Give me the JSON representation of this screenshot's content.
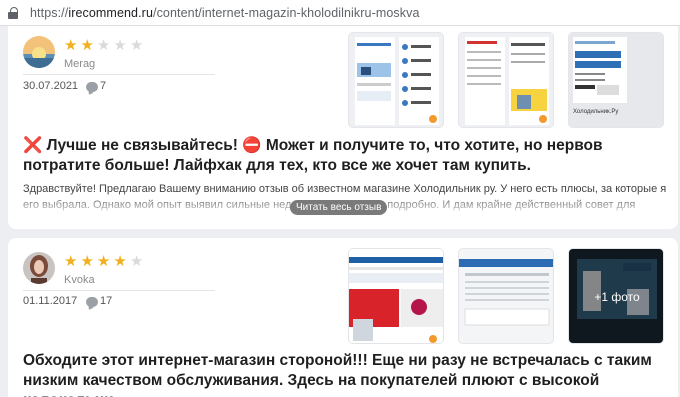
{
  "browser": {
    "url_prefix": "https://",
    "url_domain": "irecommend.ru",
    "url_path": "/content/internet-magazin-kholodilnikru-moskva"
  },
  "reviews": [
    {
      "username": "Merag",
      "rating": 2,
      "rating_max": 5,
      "date": "30.07.2021",
      "comments": "7",
      "title": "❌ Лучше не связывайтесь! ⛔ Может и получите то, что хотите, но нервов потратите больше! Лайфхак для тех, кто все же хочет там купить.",
      "text": "Здравствуйте! Предлагаю Вашему вниманию отзыв об известном магазине Холодильник ру. У него есть плюсы, за которые я его выбрала. Однако мой опыт выявил сильные недостатки. Расскажу подробно. И дам крайне действенный совет для",
      "read_more": "Читать весь отзыв",
      "thumb3_caption": "Холодильник.Ру"
    },
    {
      "username": "Kvoka",
      "rating": 4,
      "rating_max": 5,
      "date": "01.11.2017",
      "comments": "17",
      "title": "Обходите этот интернет-магазин стороной!!! Еще ни разу не встречалась с таким низким качеством обслуживания. Здесь на покупателей плюют с высокой колокольни.",
      "more_photos": "+1 фото"
    }
  ],
  "colors": {
    "star_on": "#f2b01e",
    "star_off": "#dadada"
  }
}
